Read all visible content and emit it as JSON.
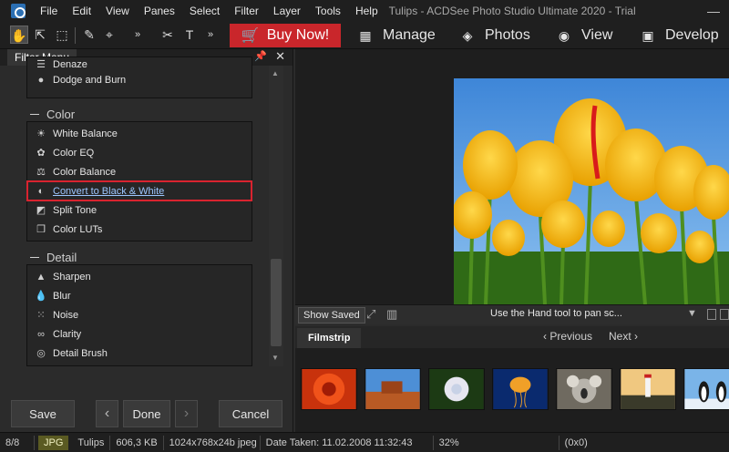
{
  "menubar": {
    "items": [
      "File",
      "Edit",
      "View",
      "Panes",
      "Select",
      "Filter",
      "Layer",
      "Tools",
      "Help"
    ],
    "title": "Tulips - ACDSee Photo Studio Ultimate 2020 - Trial"
  },
  "toolbar": {
    "buy_now": "Buy Now!",
    "modes": [
      "Manage",
      "Photos",
      "View",
      "Develop"
    ]
  },
  "panel": {
    "title": "Filter Menu",
    "top_partial_item": "Denaze",
    "top_item": "Dodge and Burn",
    "color_group": {
      "title": "Color",
      "items": [
        "White Balance",
        "Color EQ",
        "Color Balance",
        "Convert to Black & White",
        "Split Tone",
        "Color LUTs"
      ],
      "selected": "Convert to Black & White"
    },
    "detail_group": {
      "title": "Detail",
      "items": [
        "Sharpen",
        "Blur",
        "Noise",
        "Clarity",
        "Detail Brush"
      ]
    },
    "buttons": {
      "save": "Save",
      "prev": "‹",
      "done": "Done",
      "next": "›",
      "cancel": "Cancel"
    }
  },
  "viewer": {
    "show_saved": "Show Saved",
    "hint": "Use the Hand tool to pan sc..."
  },
  "filmstrip": {
    "tab": "Filmstrip",
    "previous": "Previous",
    "next": "Next"
  },
  "statusbar": {
    "index": "8/8",
    "type": "JPG",
    "name": "Tulips",
    "size": "606,3 KB",
    "dimensions": "1024x768x24b jpeg",
    "date": "Date Taken: 11.02.2008 11:32:43",
    "zoom": "32%",
    "coords": "(0x0)"
  }
}
